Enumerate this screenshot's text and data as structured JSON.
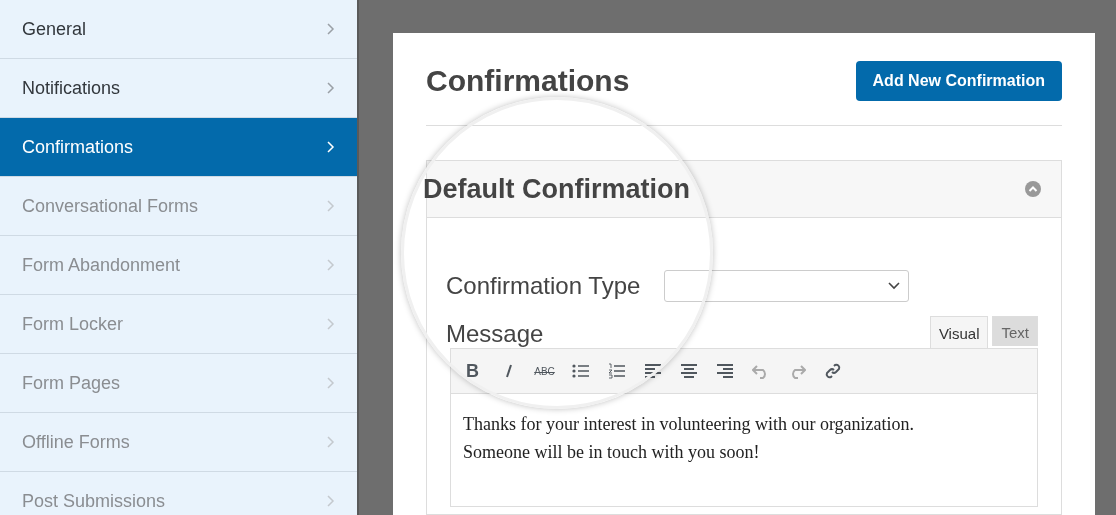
{
  "sidebar": {
    "items": [
      {
        "label": "General",
        "selected": false,
        "disabled": false
      },
      {
        "label": "Notifications",
        "selected": false,
        "disabled": false
      },
      {
        "label": "Confirmations",
        "selected": true,
        "disabled": false
      },
      {
        "label": "Conversational Forms",
        "selected": false,
        "disabled": true
      },
      {
        "label": "Form Abandonment",
        "selected": false,
        "disabled": true
      },
      {
        "label": "Form Locker",
        "selected": false,
        "disabled": true
      },
      {
        "label": "Form Pages",
        "selected": false,
        "disabled": true
      },
      {
        "label": "Offline Forms",
        "selected": false,
        "disabled": true
      },
      {
        "label": "Post Submissions",
        "selected": false,
        "disabled": true
      }
    ]
  },
  "main": {
    "title": "Confirmations",
    "add_button": "Add New Confirmation",
    "panel": {
      "title": "Default Confirmation",
      "expanded": true,
      "type_label": "Confirmation Type",
      "message_label": "Message",
      "editor_tabs": [
        {
          "label": "Visual",
          "selected": true
        },
        {
          "label": "Text",
          "selected": false
        }
      ],
      "toolbar": [
        {
          "kind": "bold",
          "label": "B"
        },
        {
          "kind": "italic"
        },
        {
          "kind": "strike",
          "label": "ABC"
        },
        {
          "kind": "bullets"
        },
        {
          "kind": "numbers"
        },
        {
          "kind": "align-left"
        },
        {
          "kind": "align-center"
        },
        {
          "kind": "align-right"
        },
        {
          "kind": "undo"
        },
        {
          "kind": "redo"
        },
        {
          "kind": "link"
        }
      ],
      "message": [
        "Thanks for your interest in volunteering with our organization.",
        "Someone will be in touch with you soon!"
      ]
    }
  }
}
